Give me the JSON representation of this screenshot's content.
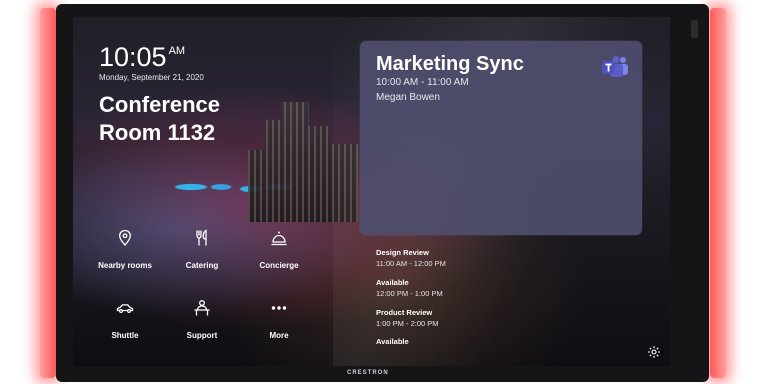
{
  "clock": {
    "time": "10:05",
    "ampm": "AM"
  },
  "date": "Monday, September 21, 2020",
  "room": {
    "line1": "Conference",
    "line2": "Room 1132"
  },
  "tiles": [
    {
      "label": "Nearby rooms",
      "icon": "location-pin-icon"
    },
    {
      "label": "Catering",
      "icon": "fork-knife-icon"
    },
    {
      "label": "Concierge",
      "icon": "service-bell-icon"
    },
    {
      "label": "Shuttle",
      "icon": "car-icon"
    },
    {
      "label": "Support",
      "icon": "support-person-icon"
    },
    {
      "label": "More",
      "icon": "more-dots-icon"
    }
  ],
  "current_meeting": {
    "title": "Marketing Sync",
    "time": "10:00 AM - 11:00 AM",
    "organizer": "Megan Bowen",
    "app_icon": "teams-icon"
  },
  "agenda": [
    {
      "name": "Design Review",
      "time": "11:00 AM - 12:00 PM"
    },
    {
      "name": "Available",
      "time": "12:00 PM - 1:00 PM"
    },
    {
      "name": "Product Review",
      "time": "1:00 PM - 2:00 PM"
    },
    {
      "name": "Available",
      "time": ""
    }
  ],
  "brand": "CRESTRON",
  "colors": {
    "accent_glow": "#ff5a5a",
    "card": "#4e4e6e",
    "teams": "#5b5fc7"
  }
}
